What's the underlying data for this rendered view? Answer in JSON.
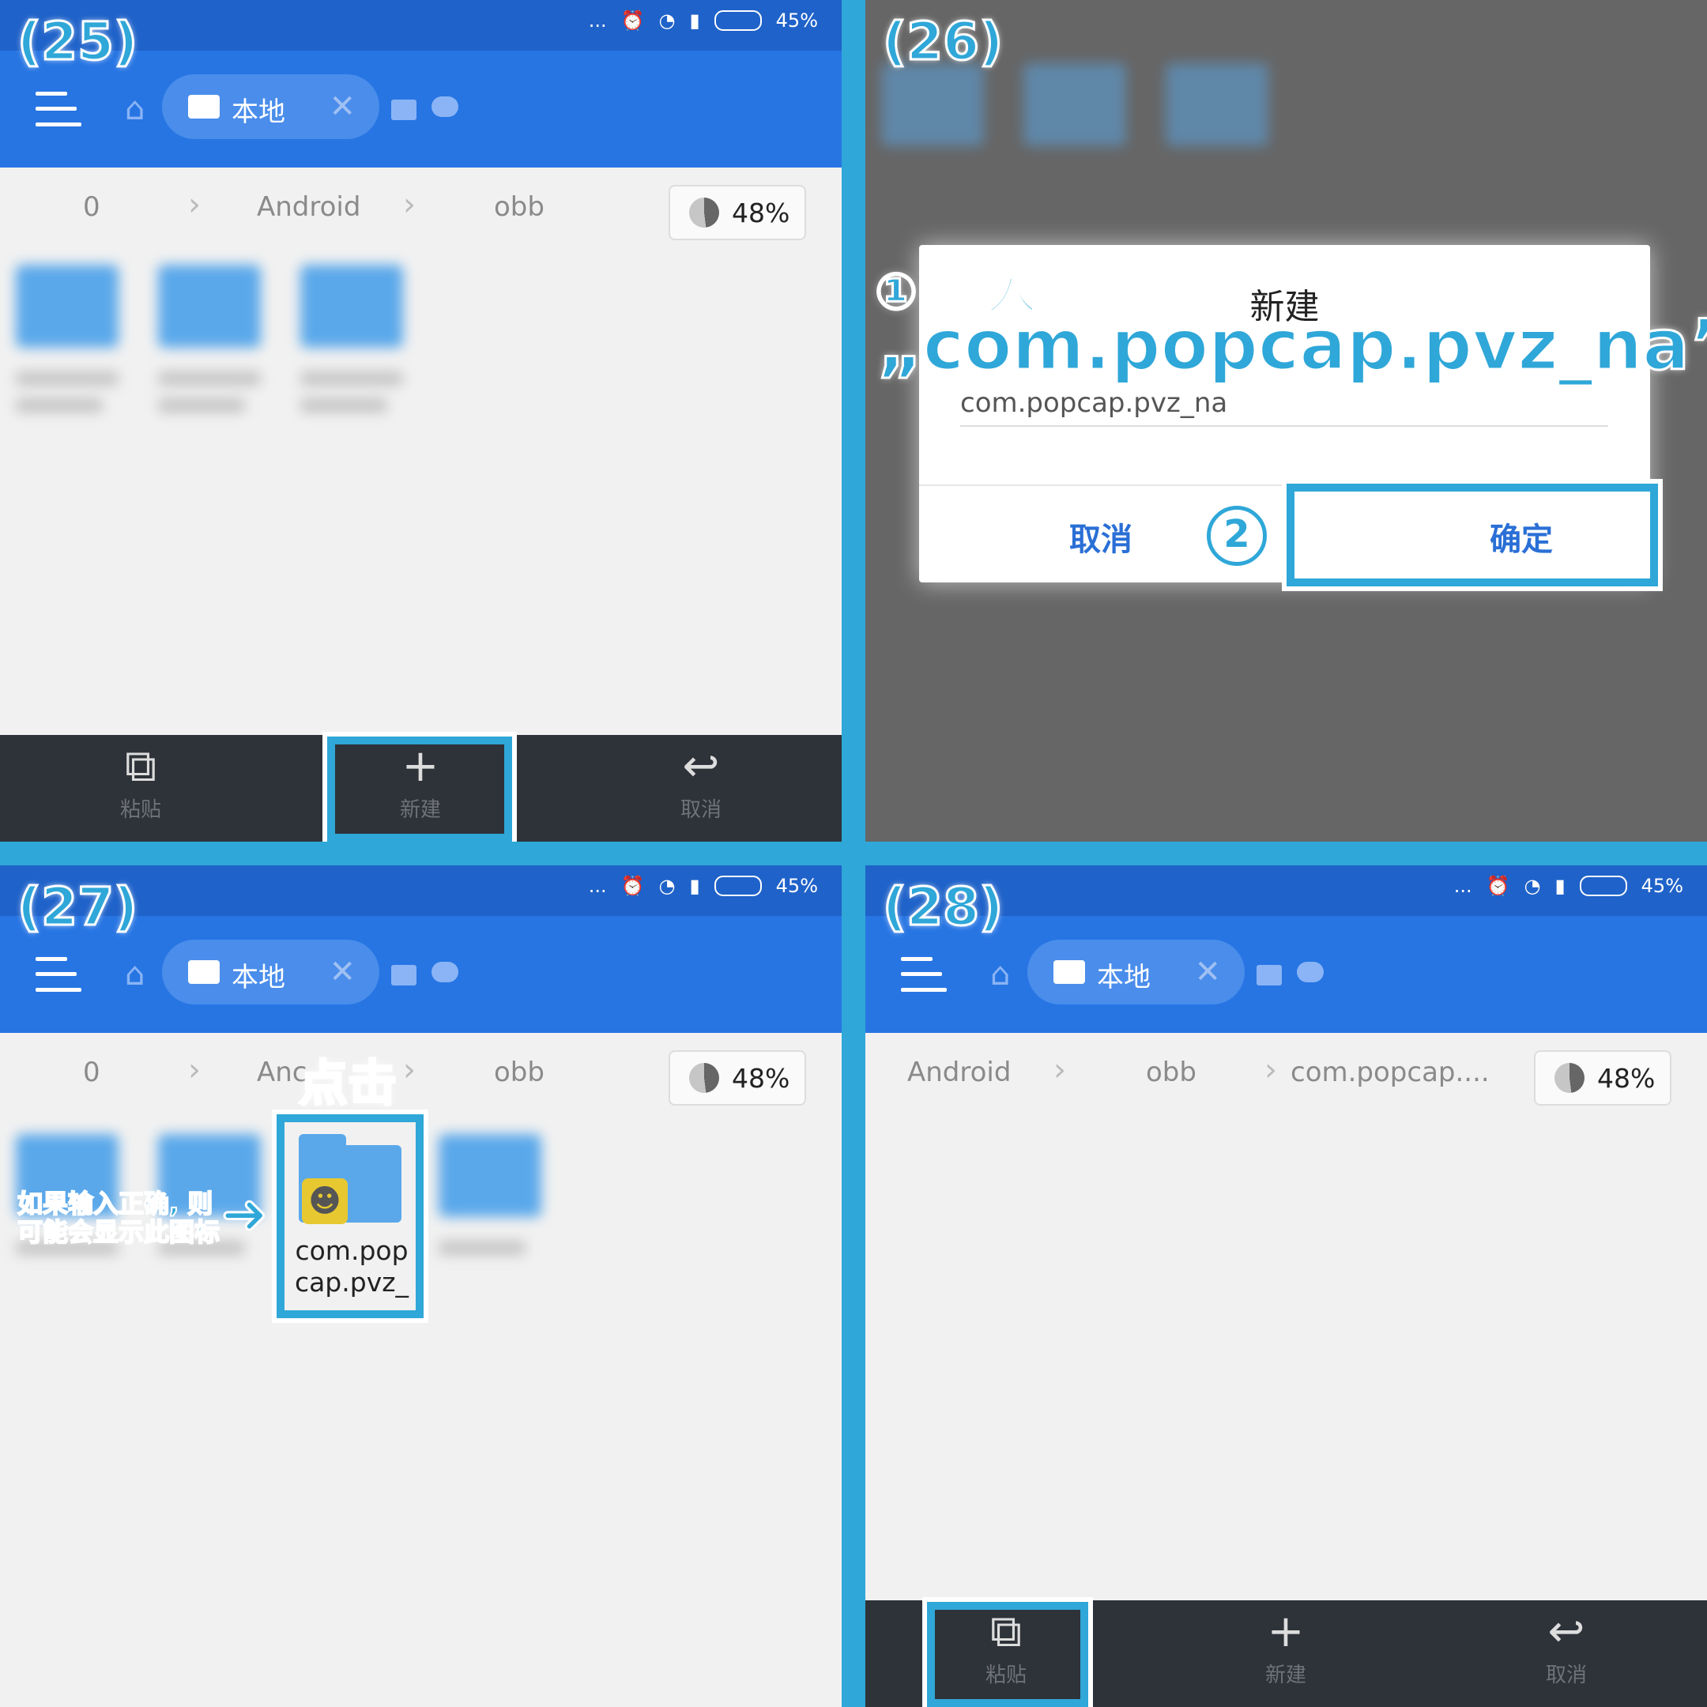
{
  "status": {
    "battery": "45%",
    "dots": "..."
  },
  "header": {
    "tab_label": "本地"
  },
  "storage": {
    "percent": "48%"
  },
  "panels": {
    "p25": {
      "step": "(25)",
      "crumbs": [
        "0",
        "Android",
        "obb"
      ]
    },
    "p26": {
      "step": "(26)",
      "dialog_title": "新建",
      "input_value": "com.popcap.pvz_na",
      "cancel": "取消",
      "confirm": "确定",
      "annot_line1": "① 输入",
      "annot_line2": "„com.popcap.pvz_na”",
      "annot_step2": "2"
    },
    "p27": {
      "step": "(27)",
      "crumbs": [
        "0",
        "Anc",
        "obb"
      ],
      "click_label": "点击",
      "hint_line1": "如果输入正确, 则",
      "hint_line2": "可能会显示此图标",
      "folder_name_1": "com.pop",
      "folder_name_2": "cap.pvz_"
    },
    "p28": {
      "step": "(28)",
      "crumbs": [
        "Android",
        "obb",
        "com.popcap...."
      ]
    }
  },
  "bottombar": {
    "paste": "粘贴",
    "new": "新建",
    "cancel": "取消"
  },
  "colors": {
    "accent": "#2fa7d8",
    "appbar": "#2775e3",
    "statusbar": "#1f62c9"
  }
}
